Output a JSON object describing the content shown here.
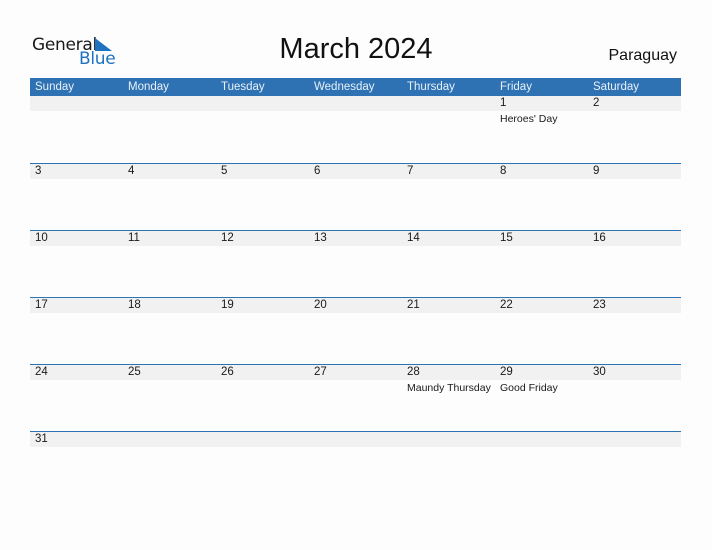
{
  "logo": {
    "general": "General",
    "blue": "Blue",
    "accent": "#1f72bd"
  },
  "header": {
    "title": "March 2024",
    "country": "Paraguay"
  },
  "colors": {
    "header_bg": "#2e72b4",
    "band_bg": "#f1f1f1"
  },
  "weekdays": [
    "Sunday",
    "Monday",
    "Tuesday",
    "Wednesday",
    "Thursday",
    "Friday",
    "Saturday"
  ],
  "weeks": [
    [
      {
        "day": "",
        "holiday": ""
      },
      {
        "day": "",
        "holiday": ""
      },
      {
        "day": "",
        "holiday": ""
      },
      {
        "day": "",
        "holiday": ""
      },
      {
        "day": "",
        "holiday": ""
      },
      {
        "day": "1",
        "holiday": "Heroes' Day"
      },
      {
        "day": "2",
        "holiday": ""
      }
    ],
    [
      {
        "day": "3",
        "holiday": ""
      },
      {
        "day": "4",
        "holiday": ""
      },
      {
        "day": "5",
        "holiday": ""
      },
      {
        "day": "6",
        "holiday": ""
      },
      {
        "day": "7",
        "holiday": ""
      },
      {
        "day": "8",
        "holiday": ""
      },
      {
        "day": "9",
        "holiday": ""
      }
    ],
    [
      {
        "day": "10",
        "holiday": ""
      },
      {
        "day": "11",
        "holiday": ""
      },
      {
        "day": "12",
        "holiday": ""
      },
      {
        "day": "13",
        "holiday": ""
      },
      {
        "day": "14",
        "holiday": ""
      },
      {
        "day": "15",
        "holiday": ""
      },
      {
        "day": "16",
        "holiday": ""
      }
    ],
    [
      {
        "day": "17",
        "holiday": ""
      },
      {
        "day": "18",
        "holiday": ""
      },
      {
        "day": "19",
        "holiday": ""
      },
      {
        "day": "20",
        "holiday": ""
      },
      {
        "day": "21",
        "holiday": ""
      },
      {
        "day": "22",
        "holiday": ""
      },
      {
        "day": "23",
        "holiday": ""
      }
    ],
    [
      {
        "day": "24",
        "holiday": ""
      },
      {
        "day": "25",
        "holiday": ""
      },
      {
        "day": "26",
        "holiday": ""
      },
      {
        "day": "27",
        "holiday": ""
      },
      {
        "day": "28",
        "holiday": "Maundy Thursday"
      },
      {
        "day": "29",
        "holiday": "Good Friday"
      },
      {
        "day": "30",
        "holiday": ""
      }
    ],
    [
      {
        "day": "31",
        "holiday": ""
      },
      {
        "day": "",
        "holiday": ""
      },
      {
        "day": "",
        "holiday": ""
      },
      {
        "day": "",
        "holiday": ""
      },
      {
        "day": "",
        "holiday": ""
      },
      {
        "day": "",
        "holiday": ""
      },
      {
        "day": "",
        "holiday": ""
      }
    ]
  ]
}
